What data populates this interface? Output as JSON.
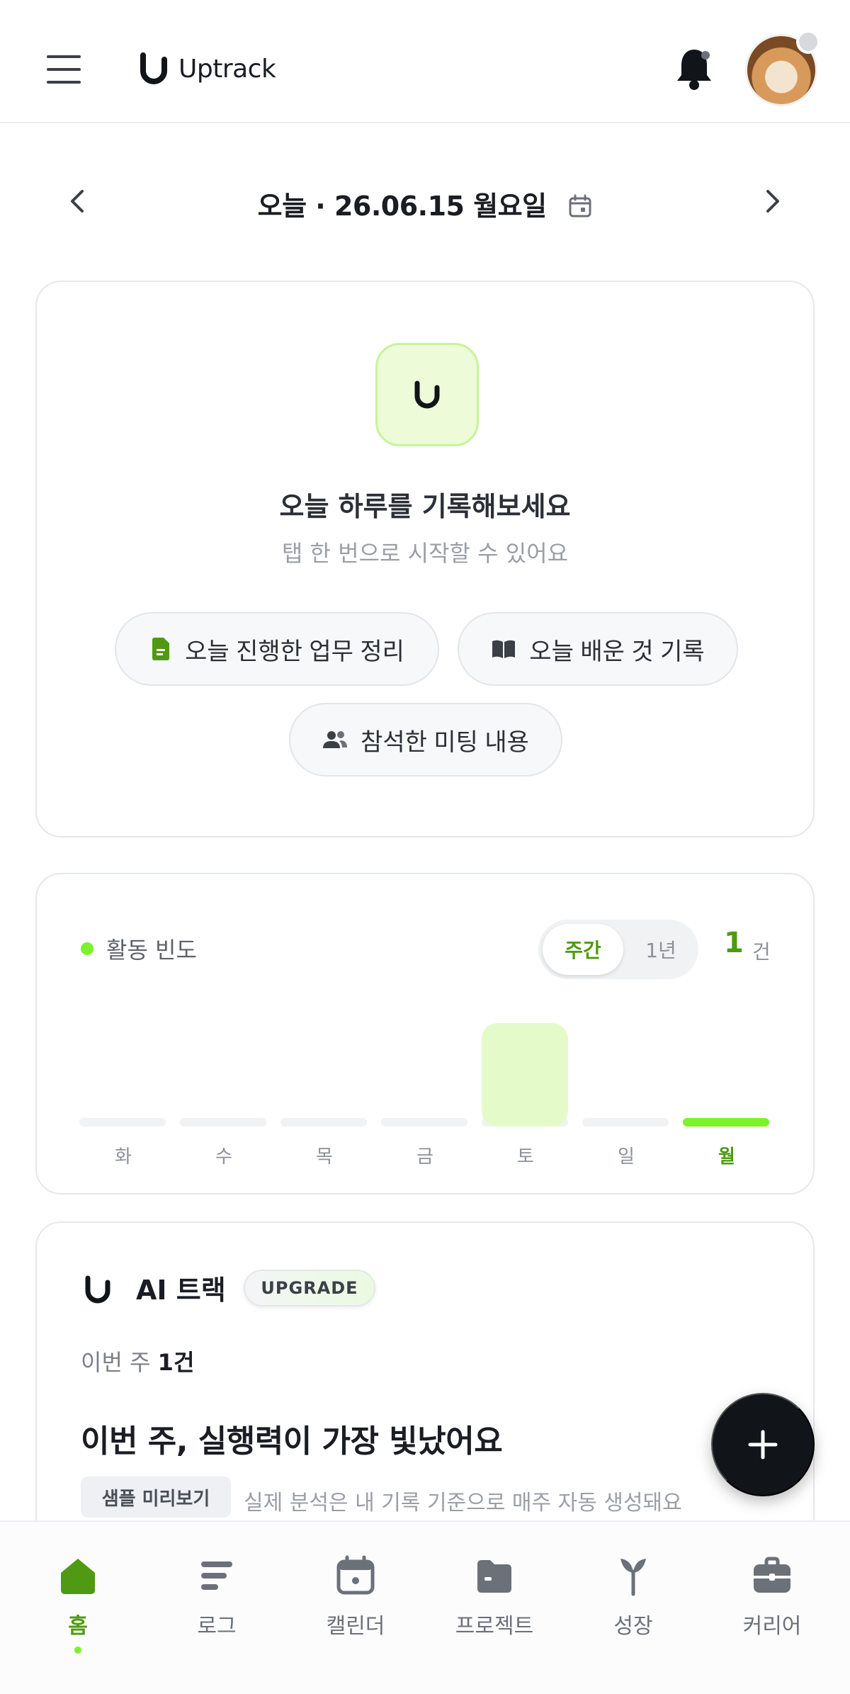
{
  "header": {
    "brand_name": "Uptrack",
    "menu_icon": "hamburger-icon",
    "bell_icon": "bell-icon"
  },
  "date_nav": {
    "title": "오늘 · 26.06.15 월요일",
    "prev_icon": "chevron-left-icon",
    "next_icon": "chevron-right-icon"
  },
  "record_card": {
    "title": "오늘 하루를 기록해보세요",
    "subtitle": "탭 한 번으로 시작할 수 있어요",
    "chips": [
      {
        "label": "오늘 진행한 업무 정리",
        "icon": "document-icon"
      },
      {
        "label": "오늘 배운 것 기록",
        "icon": "book-icon"
      },
      {
        "label": "참석한 미팅 내용",
        "icon": "people-icon"
      }
    ]
  },
  "activity": {
    "label": "활동 빈도",
    "toggle": {
      "weekly": "주간",
      "yearly": "1년",
      "selected": "주간"
    },
    "count": "1",
    "count_unit": "건"
  },
  "chart_data": {
    "type": "bar",
    "categories": [
      "화",
      "수",
      "목",
      "금",
      "토",
      "일",
      "월"
    ],
    "values": [
      0,
      0,
      0,
      0,
      1,
      0,
      0
    ],
    "highlight_category": "월",
    "colors": {
      "bar": "#e4fbc9",
      "today_track": "#7df12a",
      "track": "#f1f2f4"
    }
  },
  "ai_track": {
    "title": "AI 트랙",
    "badge": "UPGRADE",
    "week_prefix": "이번 주",
    "week_count": "1건",
    "headline": "이번 주, 실행력이 가장 빛났어요",
    "sample_label": "샘플 미리보기",
    "sample_desc": "실제 분석은 내 기록 기준으로 매주 자동 생성돼요"
  },
  "fab": {
    "icon": "plus-icon"
  },
  "bottom_nav": {
    "items": [
      {
        "label": "홈",
        "icon": "home-icon",
        "active": true
      },
      {
        "label": "로그",
        "icon": "log-icon",
        "active": false
      },
      {
        "label": "캘린더",
        "icon": "calendar-icon",
        "active": false
      },
      {
        "label": "프로젝트",
        "icon": "folder-icon",
        "active": false
      },
      {
        "label": "성장",
        "icon": "sprout-icon",
        "active": false
      },
      {
        "label": "커리어",
        "icon": "briefcase-icon",
        "active": false
      }
    ]
  },
  "colors": {
    "accent": "#7df12a",
    "accent_text": "#4f9a12",
    "dark": "#111418"
  }
}
